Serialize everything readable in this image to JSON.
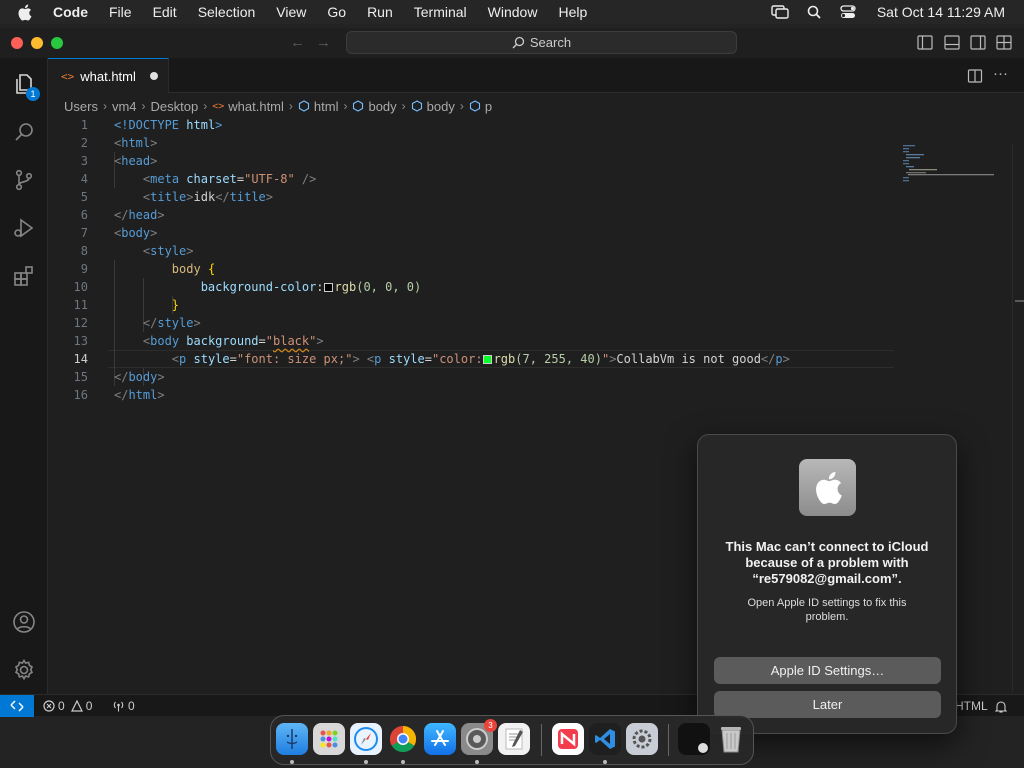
{
  "menubar": {
    "app_name": "Code",
    "items": [
      "File",
      "Edit",
      "Selection",
      "View",
      "Go",
      "Run",
      "Terminal",
      "Window",
      "Help"
    ],
    "clock": "Sat Oct 14  11:29 AM"
  },
  "titlebar": {
    "search_label": "Search"
  },
  "activitybar": {
    "explorer_badge": "1"
  },
  "tab": {
    "filename": "what.html",
    "icon_glyph": "<>"
  },
  "breadcrumb": {
    "items": [
      "Users",
      "vm4",
      "Desktop",
      "what.html",
      "html",
      "body",
      "body",
      "p"
    ]
  },
  "editor": {
    "current_line": 14,
    "line_numbers": [
      "1",
      "2",
      "3",
      "4",
      "5",
      "6",
      "7",
      "8",
      "9",
      "10",
      "11",
      "12",
      "13",
      "14",
      "15",
      "16"
    ],
    "code": {
      "l1_decl": "<!DOCTYPE",
      "l1_html": "html",
      "l1_close": ">",
      "html_tag": "html",
      "head_tag": "head",
      "meta_tag": "meta",
      "charset_attr": "charset",
      "charset_val": "\"UTF-8\"",
      "title_tag": "title",
      "title_text": "idk",
      "body_tag": "body",
      "style_tag": "style",
      "css_selector": "body",
      "brace_open": "{",
      "brace_close": "}",
      "css_prop": "background-color",
      "css_fn": "rgb",
      "css_args": "(0, 0, 0)",
      "bg_attr": "background",
      "bg_val": "black",
      "p_tag": "p",
      "style_attr": "style",
      "p1_style": "\"font: size px;\"",
      "p2_style_start": "\"color:",
      "p2_fn": "rgb",
      "p2_args": "(7, 255, 40)",
      "p2_style_end": "\"",
      "p_text": "CollabVm is not good"
    },
    "swatch_black": "#000000",
    "swatch_green": "#07ff28"
  },
  "statusbar": {
    "errors": "0",
    "warnings": "0",
    "ports": "0",
    "language": "HTML"
  },
  "dialog": {
    "title": "This Mac can’t connect to iCloud because of a problem with “re579082@gmail.com”.",
    "body": "Open Apple ID settings to fix this problem.",
    "primary_button": "Apple ID Settings…",
    "secondary_button": "Later"
  },
  "dock": {
    "settings_badge": "3"
  },
  "colors": {
    "accent": "#0078d4",
    "tag": "#569cd6",
    "attribute": "#9cdcfe",
    "string": "#ce9178"
  }
}
